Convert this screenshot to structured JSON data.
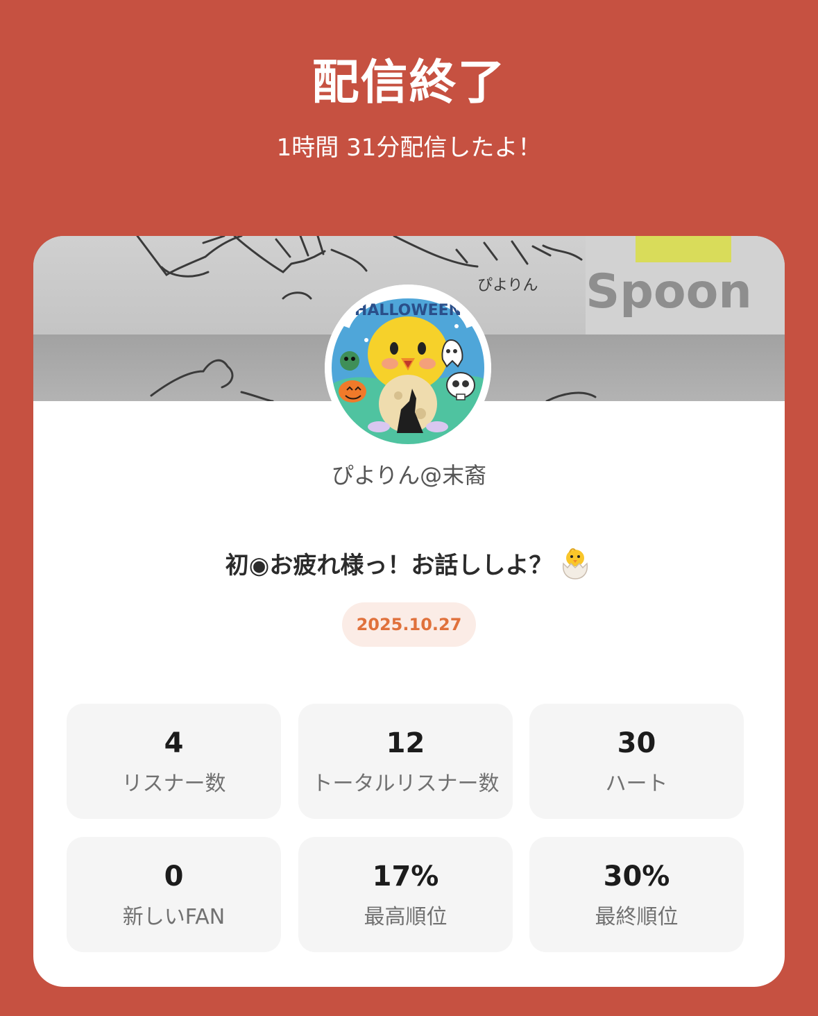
{
  "header": {
    "title": "配信終了",
    "subtitle": "1時間 31分配信したよ！"
  },
  "banner": {
    "logo_text": "Spoon",
    "background_image": "pencil-sketch-photo"
  },
  "profile": {
    "avatar_icon": "halloween-chick-avatar-icon",
    "username": "ぴよりん@末裔"
  },
  "stream": {
    "title": "初◉お疲れ様っ！お話ししよ？",
    "title_emoji": "hatching-chick-icon",
    "date": "2025.10.27"
  },
  "stats": [
    {
      "value": "4",
      "label": "リスナー数"
    },
    {
      "value": "12",
      "label": "トータルリスナー数"
    },
    {
      "value": "30",
      "label": "ハート"
    },
    {
      "value": "0",
      "label": "新しいFAN"
    },
    {
      "value": "17%",
      "label": "最高順位"
    },
    {
      "value": "30%",
      "label": "最終順位"
    }
  ],
  "colors": {
    "background": "#c65141",
    "card": "#ffffff",
    "date_pill_bg": "#fbece6",
    "date_pill_text": "#e0713c",
    "stat_tile_bg": "#f5f5f5"
  }
}
